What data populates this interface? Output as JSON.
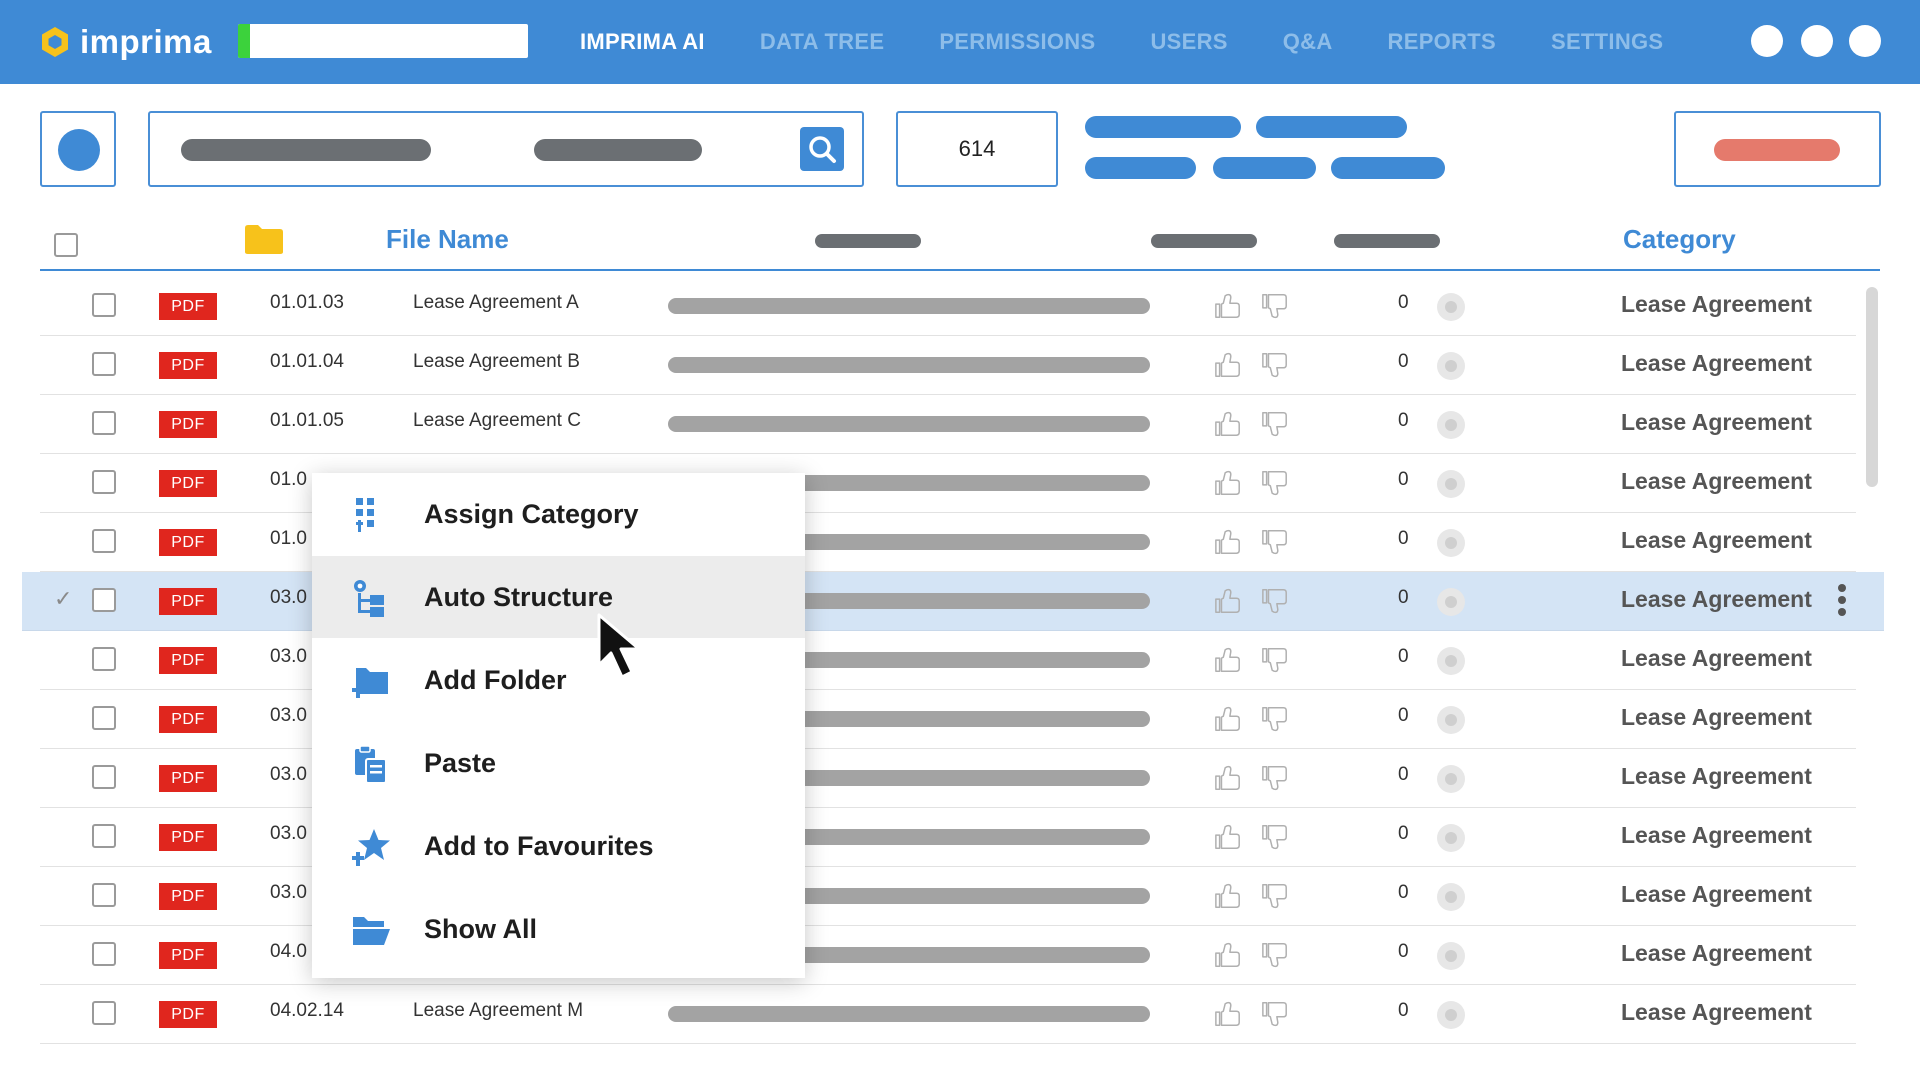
{
  "app": {
    "logo_text": "imprima",
    "upload_progress": 0.04
  },
  "nav": {
    "items": [
      {
        "label": "IMPRIMA AI",
        "active": true
      },
      {
        "label": "DATA TREE",
        "active": false
      },
      {
        "label": "PERMISSIONS",
        "active": false
      },
      {
        "label": "USERS",
        "active": false
      },
      {
        "label": "Q&A",
        "active": false
      },
      {
        "label": "REPORTS",
        "active": false
      },
      {
        "label": "SETTINGS",
        "active": false
      }
    ]
  },
  "toolbar": {
    "document_count": "614"
  },
  "table": {
    "headers": {
      "file_name": "File Name",
      "category": "Category"
    },
    "rows": [
      {
        "code": "01.01.03",
        "name": "Lease Agreement A",
        "badge": "PDF",
        "count": "0",
        "category": "Lease Agreement",
        "selected": false
      },
      {
        "code": "01.01.04",
        "name": "Lease Agreement B",
        "badge": "PDF",
        "count": "0",
        "category": "Lease Agreement",
        "selected": false
      },
      {
        "code": "01.01.05",
        "name": "Lease Agreement C",
        "badge": "PDF",
        "count": "0",
        "category": "Lease Agreement",
        "selected": false
      },
      {
        "code": "01.0",
        "name": "",
        "badge": "PDF",
        "count": "0",
        "category": "Lease Agreement",
        "selected": false
      },
      {
        "code": "01.0",
        "name": "",
        "badge": "PDF",
        "count": "0",
        "category": "Lease Agreement",
        "selected": false
      },
      {
        "code": "03.0",
        "name": "",
        "badge": "PDF",
        "count": "0",
        "category": "Lease Agreement",
        "selected": true
      },
      {
        "code": "03.0",
        "name": "",
        "badge": "PDF",
        "count": "0",
        "category": "Lease Agreement",
        "selected": false
      },
      {
        "code": "03.0",
        "name": "",
        "badge": "PDF",
        "count": "0",
        "category": "Lease Agreement",
        "selected": false
      },
      {
        "code": "03.0",
        "name": "",
        "badge": "PDF",
        "count": "0",
        "category": "Lease Agreement",
        "selected": false
      },
      {
        "code": "03.0",
        "name": "",
        "badge": "PDF",
        "count": "0",
        "category": "Lease Agreement",
        "selected": false
      },
      {
        "code": "03.0",
        "name": "",
        "badge": "PDF",
        "count": "0",
        "category": "Lease Agreement",
        "selected": false
      },
      {
        "code": "04.0",
        "name": "",
        "badge": "PDF",
        "count": "0",
        "category": "Lease Agreement",
        "selected": false
      },
      {
        "code": "04.02.14",
        "name": "Lease Agreement M",
        "badge": "PDF",
        "count": "0",
        "category": "Lease Agreement",
        "selected": false
      }
    ]
  },
  "context_menu": {
    "items": [
      {
        "label": "Assign Category",
        "icon": "assign-category-icon",
        "hover": false
      },
      {
        "label": "Auto Structure",
        "icon": "auto-structure-icon",
        "hover": true
      },
      {
        "label": "Add Folder",
        "icon": "add-folder-icon",
        "hover": false
      },
      {
        "label": "Paste",
        "icon": "paste-icon",
        "hover": false
      },
      {
        "label": "Add to Favourites",
        "icon": "add-favourite-icon",
        "hover": false
      },
      {
        "label": "Show All",
        "icon": "show-all-icon",
        "hover": false
      }
    ]
  },
  "colors": {
    "brand_blue": "#3f8ad5",
    "pdf_red": "#e0261e",
    "progress_green": "#3cd23c",
    "accent_salmon": "#e57a6c",
    "logo_yellow": "#f7c21b"
  }
}
